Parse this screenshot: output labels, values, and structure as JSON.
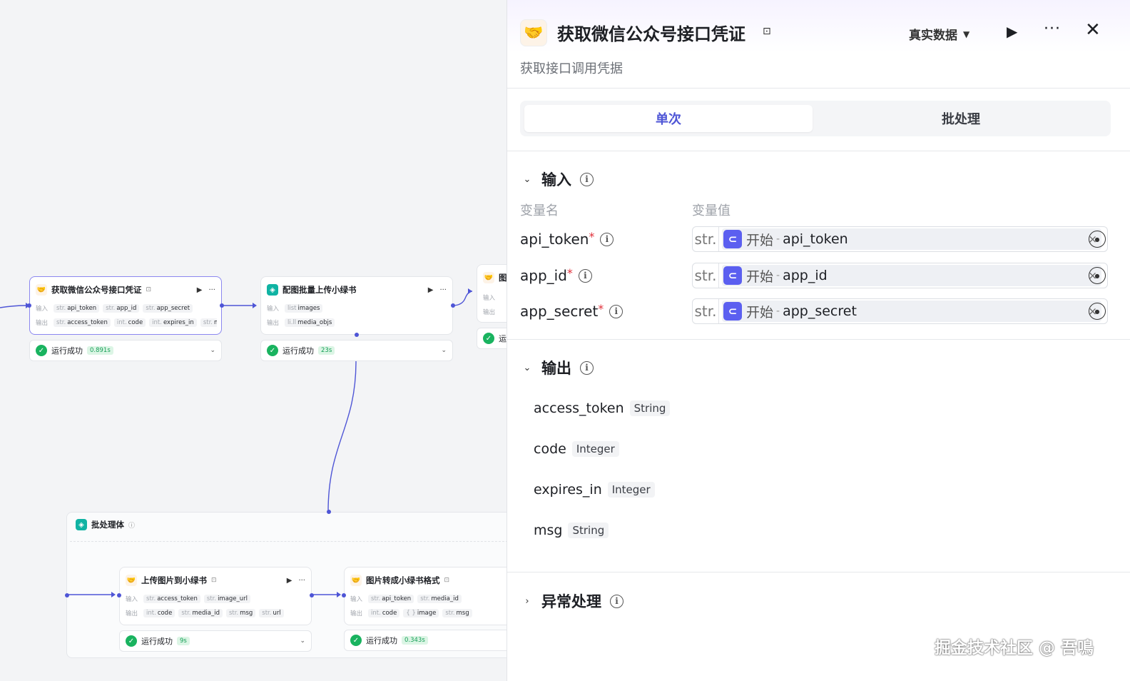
{
  "canvas": {
    "node1": {
      "title": "获取微信公众号接口凭证",
      "inputs_label": "输入",
      "outputs_label": "输出",
      "inputs": [
        {
          "type": "str.",
          "name": "api_token"
        },
        {
          "type": "str.",
          "name": "app_id"
        },
        {
          "type": "str.",
          "name": "app_secret"
        }
      ],
      "outputs": [
        {
          "type": "str.",
          "name": "access_token"
        },
        {
          "type": "int.",
          "name": "code"
        },
        {
          "type": "int.",
          "name": "expires_in"
        },
        {
          "type": "str.",
          "name": "msg"
        }
      ],
      "status": "运行成功",
      "time": "0.891s"
    },
    "node2": {
      "title": "配图批量上传小绿书",
      "inputs_label": "输入",
      "outputs_label": "输出",
      "inputs": [
        {
          "type": "list",
          "name": "images"
        }
      ],
      "outputs": [
        {
          "type": "li.ll",
          "name": "media_objs"
        }
      ],
      "status": "运行成功",
      "time": "23s"
    },
    "node3": {
      "title": "图",
      "inputs_label": "输入",
      "outputs_label": "输出",
      "status": "运"
    },
    "batch": {
      "title": "批处理体"
    },
    "node4": {
      "title": "上传图片到小绿书",
      "inputs_label": "输入",
      "outputs_label": "输出",
      "inputs": [
        {
          "type": "str.",
          "name": "access_token"
        },
        {
          "type": "str.",
          "name": "image_url"
        }
      ],
      "outputs": [
        {
          "type": "int.",
          "name": "code"
        },
        {
          "type": "str.",
          "name": "media_id"
        },
        {
          "type": "str.",
          "name": "msg"
        },
        {
          "type": "str.",
          "name": "url"
        }
      ],
      "status": "运行成功",
      "time": "9s"
    },
    "node5": {
      "title": "图片转成小绿书格式",
      "inputs_label": "输入",
      "outputs_label": "输出",
      "inputs": [
        {
          "type": "str.",
          "name": "api_token"
        },
        {
          "type": "str.",
          "name": "media_id"
        }
      ],
      "outputs": [
        {
          "type": "int.",
          "name": "code"
        },
        {
          "type": "{ }",
          "name": "image"
        },
        {
          "type": "str.",
          "name": "msg"
        }
      ],
      "status": "运行成功",
      "time": "0.343s"
    }
  },
  "panel": {
    "title": "获取微信公众号接口凭证",
    "description": "获取接口调用凭据",
    "mode": "真实数据",
    "tabs": [
      "单次",
      "批处理"
    ],
    "input_section": {
      "title": "输入",
      "col_name": "变量名",
      "col_value": "变量值",
      "vars": [
        {
          "name": "api_token",
          "type": "str.",
          "ref_node": "开始",
          "ref_var": "api_token"
        },
        {
          "name": "app_id",
          "type": "str.",
          "ref_node": "开始",
          "ref_var": "app_id"
        },
        {
          "name": "app_secret",
          "type": "str.",
          "ref_node": "开始",
          "ref_var": "app_secret"
        }
      ]
    },
    "output_section": {
      "title": "输出",
      "vars": [
        {
          "name": "access_token",
          "type": "String"
        },
        {
          "name": "code",
          "type": "Integer"
        },
        {
          "name": "expires_in",
          "type": "Integer"
        },
        {
          "name": "msg",
          "type": "String"
        }
      ]
    },
    "error_section": {
      "title": "异常处理"
    }
  },
  "watermark": "掘金技术社区 @ 吾鳴",
  "colors": {
    "accent": "#4e55d6",
    "edge": "#4e55d6",
    "success": "#19b35f",
    "required": "#e0303a"
  }
}
